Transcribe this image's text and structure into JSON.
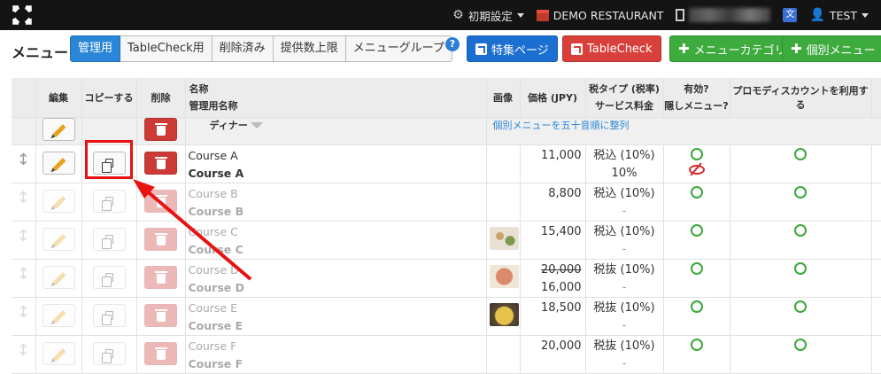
{
  "topbar": {
    "settings_label": "初期設定",
    "restaurant_label": "DEMO RESTAURANT",
    "lang_glyph": "文",
    "user_label": "TEST"
  },
  "toolbar": {
    "title": "メニュー",
    "tabs": [
      {
        "label": "管理用",
        "active": true
      },
      {
        "label": "TableCheck用",
        "active": false
      },
      {
        "label": "削除済み",
        "active": false
      },
      {
        "label": "提供数上限",
        "active": false
      },
      {
        "label": "メニューグループ",
        "active": false
      }
    ],
    "help_glyph": "?",
    "feature_page_label": "特集ページ",
    "tablecheck_label": "TableCheck",
    "add_category_label": "メニューカテゴリ",
    "add_item_label": "個別メニュー"
  },
  "table": {
    "headers": {
      "edit": "編集",
      "copy": "コピーする",
      "delete": "削除",
      "name": "名称",
      "admin_name": "管理用名称",
      "image": "画像",
      "price": "価格 (JPY)",
      "tax_type": "税タイプ (税率)",
      "service_fee": "サービス料金",
      "enabled": "有効?",
      "hidden": "隠しメニュー?",
      "promo": "プロモディスカウントを利用する"
    },
    "category": {
      "name": "ディナー",
      "sort_link": "個別メニューを五十音順に整列"
    },
    "rows": [
      {
        "name": "Course A",
        "admin_name": "Course A",
        "price": "11,000",
        "old_price": "",
        "tax": "税込 (10%)",
        "service": "10%",
        "image": "",
        "active": true,
        "hidden": true
      },
      {
        "name": "Course B",
        "admin_name": "Course B",
        "price": "8,800",
        "old_price": "",
        "tax": "税込 (10%)",
        "service": "-",
        "image": "",
        "active": false,
        "hidden": false
      },
      {
        "name": "Course C",
        "admin_name": "Course C",
        "price": "15,400",
        "old_price": "",
        "tax": "税込 (10%)",
        "service": "-",
        "image": "dish-photo-1",
        "active": false,
        "hidden": false
      },
      {
        "name": "Course D",
        "admin_name": "Course D",
        "price": "16,000",
        "old_price": "20,000",
        "tax": "税抜 (10%)",
        "service": "-",
        "image": "dish-photo-2",
        "active": false,
        "hidden": false
      },
      {
        "name": "Course E",
        "admin_name": "Course E",
        "price": "18,500",
        "old_price": "",
        "tax": "税抜 (10%)",
        "service": "-",
        "image": "dish-photo-3",
        "active": false,
        "hidden": false
      },
      {
        "name": "Course F",
        "admin_name": "Course F",
        "price": "20,000",
        "old_price": "",
        "tax": "税抜 (10%)",
        "service": "-",
        "image": "",
        "active": false,
        "hidden": false
      }
    ]
  },
  "annotation": {
    "highlight_color": "#e81212"
  }
}
